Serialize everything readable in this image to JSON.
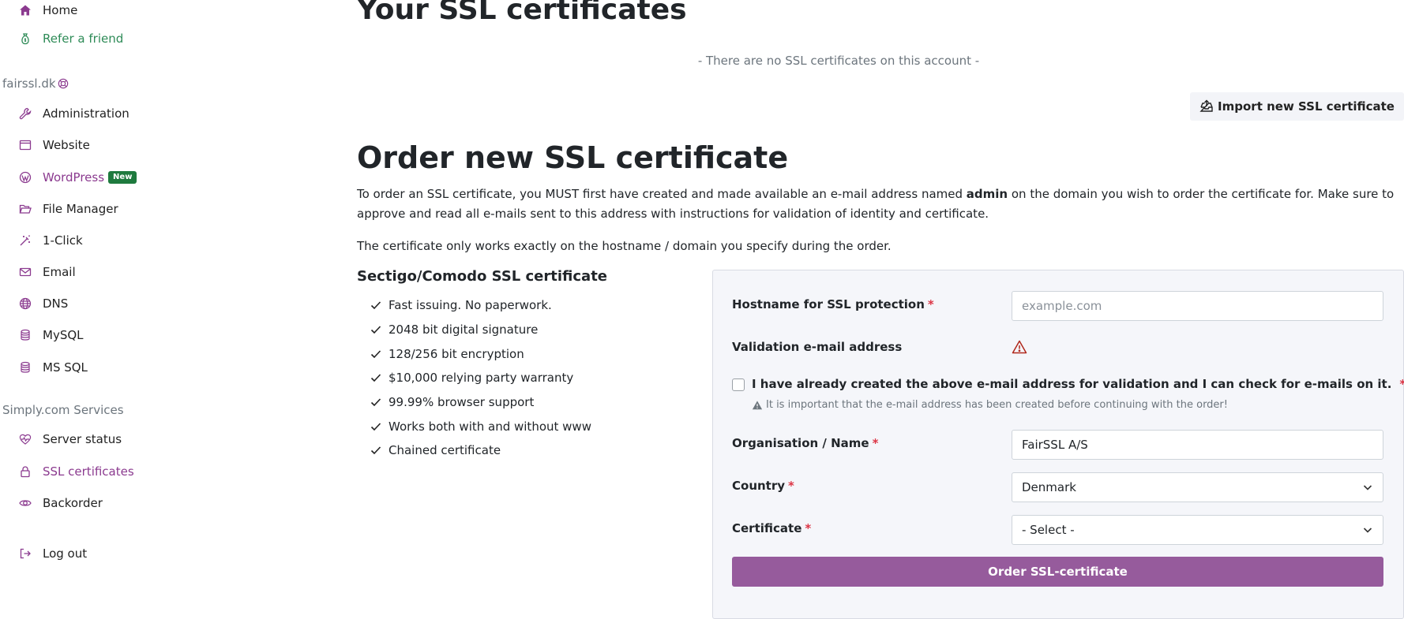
{
  "sidebar": {
    "home": "Home",
    "refer": "Refer a friend",
    "account_label": "fairssl.dk",
    "items": [
      {
        "label": "Administration"
      },
      {
        "label": "Website"
      },
      {
        "label": "WordPress",
        "badge": "New"
      },
      {
        "label": "File Manager"
      },
      {
        "label": "1-Click"
      },
      {
        "label": "Email"
      },
      {
        "label": "DNS"
      },
      {
        "label": "MySQL"
      },
      {
        "label": "MS SQL"
      }
    ],
    "services_label": "Simply.com Services",
    "services": [
      {
        "label": "Server status"
      },
      {
        "label": "SSL certificates"
      },
      {
        "label": "Backorder"
      }
    ],
    "logout": "Log out"
  },
  "main": {
    "title": "Your SSL certificates",
    "empty_message": "- There are no SSL certificates on this account -",
    "import_button": "Import new SSL certificate",
    "order_title": "Order new SSL certificate",
    "intro_pre": "To order an SSL certificate, you MUST first have created and made available an e-mail address named ",
    "intro_bold": "admin",
    "intro_post": " on the domain you wish to order the certificate for. Make sure to approve and read all e-mails sent to this address with instructions for validation of identity and certificate.",
    "intro2": "The certificate only works exactly on the hostname / domain you specify during the order.",
    "features_title": "Sectigo/Comodo SSL certificate",
    "features": [
      "Fast issuing. No paperwork.",
      "2048 bit digital signature",
      "128/256 bit encryption",
      "$10,000 relying party warranty",
      "99.99% browser support",
      "Works both with and without www",
      "Chained certificate"
    ]
  },
  "form": {
    "hostname_label": "Hostname for SSL protection",
    "hostname_placeholder": "example.com",
    "validation_label": "Validation e-mail address",
    "checkbox_label": "I have already created the above e-mail address for validation and I can check for e-mails on it.",
    "note": "It is important that the e-mail address has been created before continuing with the order!",
    "org_label": "Organisation / Name",
    "org_value": "FairSSL A/S",
    "country_label": "Country",
    "country_value": "Denmark",
    "certificate_label": "Certificate",
    "certificate_value": "- Select -",
    "submit": "Order SSL-certificate",
    "required_mark": "*"
  },
  "colors": {
    "brand_purple": "#965b9c",
    "link_purple": "#8b3a8f",
    "link_green": "#2e8b57",
    "badge_green": "#1e7a3e",
    "required_red": "#dc3545"
  }
}
